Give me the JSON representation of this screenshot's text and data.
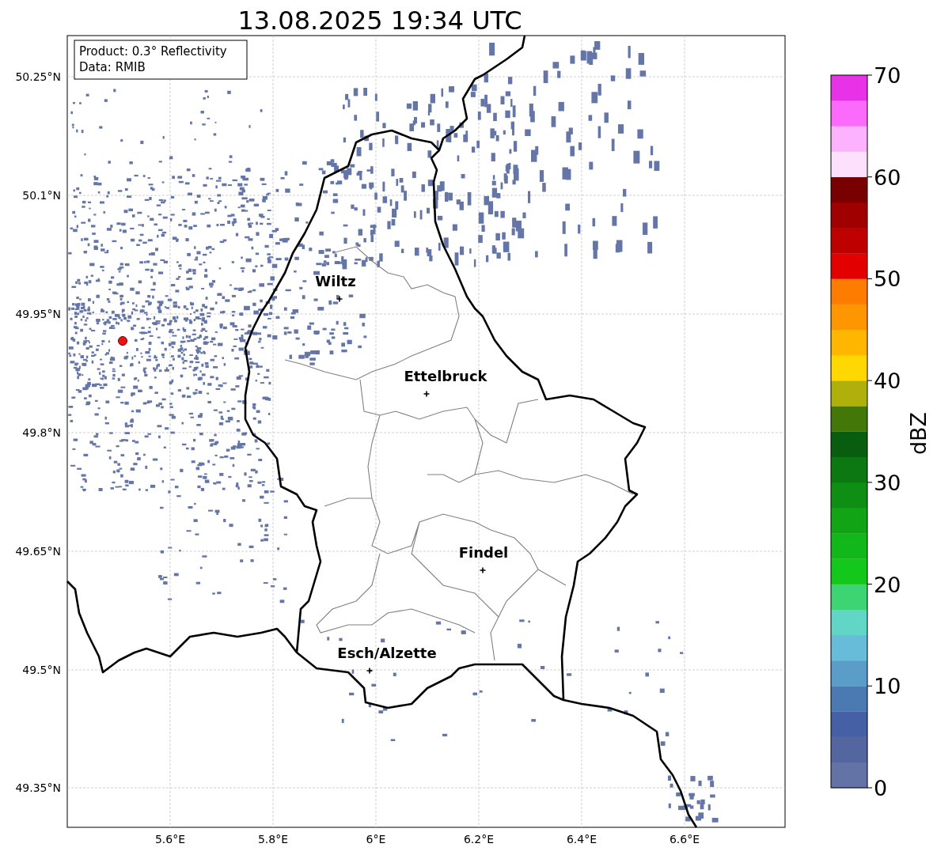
{
  "title": "13.08.2025 19:34 UTC",
  "info_box": {
    "lines": [
      "Product: 0.3° Reflectivity",
      "Data: RMIB"
    ]
  },
  "map": {
    "yticks": [
      "50.25°N",
      "50.1°N",
      "49.95°N",
      "49.8°N",
      "49.65°N",
      "49.5°N",
      "49.35°N"
    ],
    "xticks": [
      "5.6°E",
      "5.8°E",
      "6°E",
      "6.2°E",
      "6.4°E",
      "6.6°E"
    ],
    "cities": [
      {
        "name": "Wiltz"
      },
      {
        "name": "Ettelbruck"
      },
      {
        "name": "Findel"
      },
      {
        "name": "Esch/Alzette"
      }
    ]
  },
  "colorbar": {
    "label": "dBZ",
    "ticks": [
      "70",
      "60",
      "50",
      "40",
      "30",
      "20",
      "10",
      "0"
    ],
    "segments": [
      {
        "color": "#6473a6"
      },
      {
        "color": "#5366a0"
      },
      {
        "color": "#4560a4"
      },
      {
        "color": "#4b79b1"
      },
      {
        "color": "#5a9dc8"
      },
      {
        "color": "#66bcd9"
      },
      {
        "color": "#62d6c6"
      },
      {
        "color": "#3dd474"
      },
      {
        "color": "#14c81b"
      },
      {
        "color": "#12b81a"
      },
      {
        "color": "#11a515"
      },
      {
        "color": "#0e8e13"
      },
      {
        "color": "#0c7811"
      },
      {
        "color": "#085e0e"
      },
      {
        "color": "#437808"
      },
      {
        "color": "#b0b00a"
      },
      {
        "color": "#fed800"
      },
      {
        "color": "#feb600"
      },
      {
        "color": "#fd9600"
      },
      {
        "color": "#fe7d00"
      },
      {
        "color": "#e20000"
      },
      {
        "color": "#bf0000"
      },
      {
        "color": "#a00000"
      },
      {
        "color": "#780000"
      },
      {
        "color": "#fde0fc"
      },
      {
        "color": "#fdb2fd"
      },
      {
        "color": "#fc6afc"
      },
      {
        "color": "#e832e8"
      }
    ]
  }
}
